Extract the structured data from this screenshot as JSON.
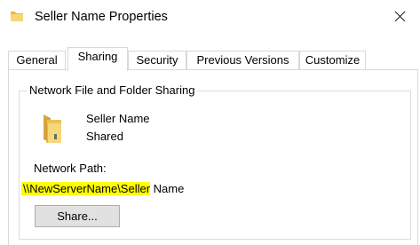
{
  "window": {
    "title": "Seller Name Properties",
    "title_icon": "folder-icon",
    "close_icon": "close-icon"
  },
  "tabs": [
    {
      "label": "General",
      "active": false
    },
    {
      "label": "Sharing",
      "active": true
    },
    {
      "label": "Security",
      "active": false
    },
    {
      "label": "Previous Versions",
      "active": false
    },
    {
      "label": "Customize",
      "active": false
    }
  ],
  "sharing": {
    "group_title": "Network File and Folder Sharing",
    "folder_icon": "shared-folder-icon",
    "share_name": "Seller Name",
    "share_status": "Shared",
    "network_path_label": "Network Path:",
    "network_path_highlighted": "\\\\NewServerName\\Seller",
    "network_path_rest": " Name",
    "highlight_color": "#ffff00",
    "share_button_label": "Share..."
  }
}
